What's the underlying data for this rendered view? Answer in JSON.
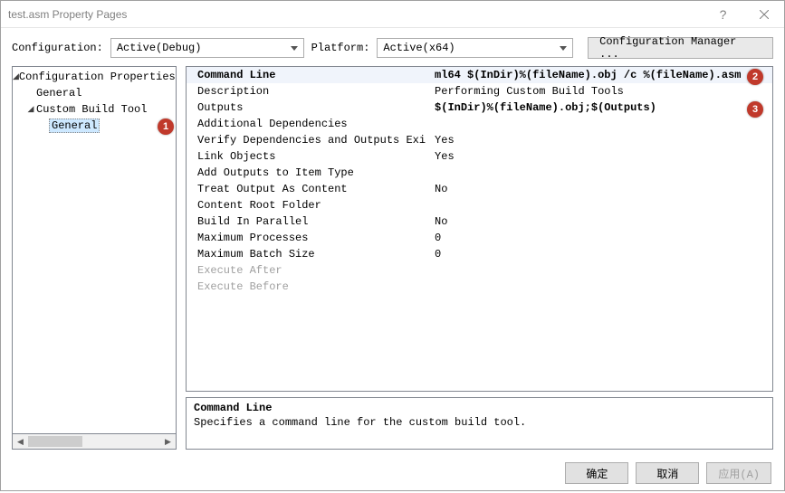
{
  "window": {
    "title": "test.asm Property Pages"
  },
  "toolbar": {
    "configuration_label": "Configuration:",
    "configuration_value": "Active(Debug)",
    "platform_label": "Platform:",
    "platform_value": "Active(x64)",
    "config_mgr_label": "Configuration Manager ..."
  },
  "tree": {
    "root": "Configuration Properties",
    "items": [
      {
        "label": "General"
      },
      {
        "label": "Custom Build Tool",
        "children": [
          {
            "label": "General",
            "selected": true
          }
        ]
      }
    ]
  },
  "properties": [
    {
      "name": "Command Line",
      "value": "ml64 $(InDir)%(fileName).obj /c %(fileName).asm",
      "bold": true,
      "selected": true
    },
    {
      "name": "Description",
      "value": "Performing Custom Build Tools"
    },
    {
      "name": "Outputs",
      "value": "$(InDir)%(fileName).obj;$(Outputs)",
      "bold": true
    },
    {
      "name": "Additional Dependencies",
      "value": ""
    },
    {
      "name": "Verify Dependencies and Outputs Exist",
      "value": "Yes",
      "truncatedName": "Verify Dependencies and Outputs Exi"
    },
    {
      "name": "Link Objects",
      "value": "Yes"
    },
    {
      "name": "Add Outputs to Item Type",
      "value": ""
    },
    {
      "name": "Treat Output As Content",
      "value": "No"
    },
    {
      "name": "Content Root Folder",
      "value": ""
    },
    {
      "name": "Build In Parallel",
      "value": "No"
    },
    {
      "name": "Maximum Processes",
      "value": "0"
    },
    {
      "name": "Maximum Batch Size",
      "value": "0"
    },
    {
      "name": "Execute After",
      "value": "",
      "grey": true
    },
    {
      "name": "Execute Before",
      "value": "",
      "grey": true
    }
  ],
  "description": {
    "title": "Command Line",
    "text": "Specifies a command line for the custom build tool."
  },
  "buttons": {
    "ok": "确定",
    "cancel": "取消",
    "apply": "应用(A)"
  },
  "annotations": {
    "b1": "1",
    "b2": "2",
    "b3": "3"
  }
}
